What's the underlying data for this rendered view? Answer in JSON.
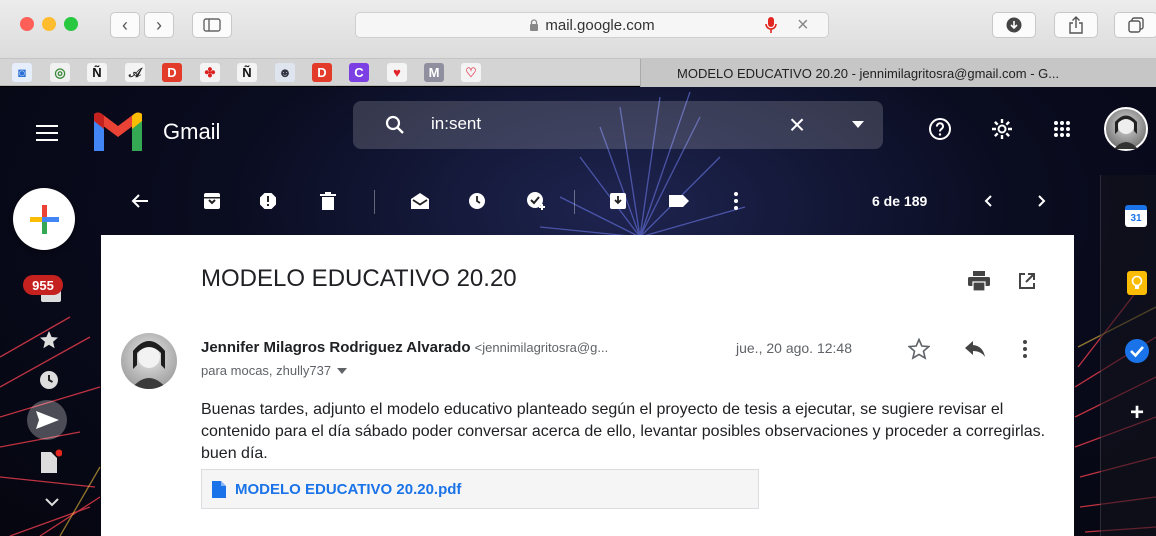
{
  "browser": {
    "url": "mail.google.com",
    "tab_title": "MODELO EDUCATIVO 20.20 - jennimilagritosra@gmail.com - G...",
    "bookmarks": [
      {
        "glyph": "◙",
        "color": "#2a6fd6",
        "bg": "#e6eefc"
      },
      {
        "glyph": "◎",
        "color": "#3a8a3a",
        "bg": "#f1f1f1"
      },
      {
        "glyph": "Ñ",
        "color": "#111",
        "bg": "#f4f4f4"
      },
      {
        "glyph": "𝒜",
        "color": "#222",
        "bg": "#f4f4f4"
      },
      {
        "glyph": "D",
        "color": "#fff",
        "bg": "#e23b2a"
      },
      {
        "glyph": "✤",
        "color": "#d22",
        "bg": "#f4f4f4"
      },
      {
        "glyph": "Ñ",
        "color": "#111",
        "bg": "#f4f4f4"
      },
      {
        "glyph": "☻",
        "color": "#334",
        "bg": "#dfe5ee"
      },
      {
        "glyph": "D",
        "color": "#fff",
        "bg": "#e23b2a"
      },
      {
        "glyph": "C",
        "color": "#fff",
        "bg": "#7b3fe4"
      },
      {
        "glyph": "♥",
        "color": "#e2242a",
        "bg": "#f4f4f4"
      },
      {
        "glyph": "M",
        "color": "#fff",
        "bg": "#8f8fa0"
      },
      {
        "glyph": "♡",
        "color": "#e05a6a",
        "bg": "#f4f4f4"
      }
    ]
  },
  "gmail": {
    "logo_text": "Gmail",
    "search_query": "in:sent",
    "badge_count": "955",
    "pagination": "6 de 189",
    "calendar_day": "31"
  },
  "email": {
    "subject": "MODELO EDUCATIVO 20.20",
    "sender_name": "Jennifer Milagros Rodriguez Alvarado",
    "sender_email": "<jennimilagritosra@g...",
    "date": "jue., 20 ago. 12:48",
    "recipients": "para mocas, zhully737",
    "body": "Buenas tardes, adjunto el modelo educativo planteado según el proyecto de tesis a ejecutar, se sugiere revisar el contenido para el día sábado poder conversar acerca de ello, levantar posibles observaciones y proceder a corregirlas. buen día.",
    "attachment": "MODELO EDUCATIVO 20.20.pdf"
  },
  "colors": {
    "accent_blue": "#1a73e8",
    "badge_red": "#c5221f",
    "mic_red": "#e3261f"
  }
}
